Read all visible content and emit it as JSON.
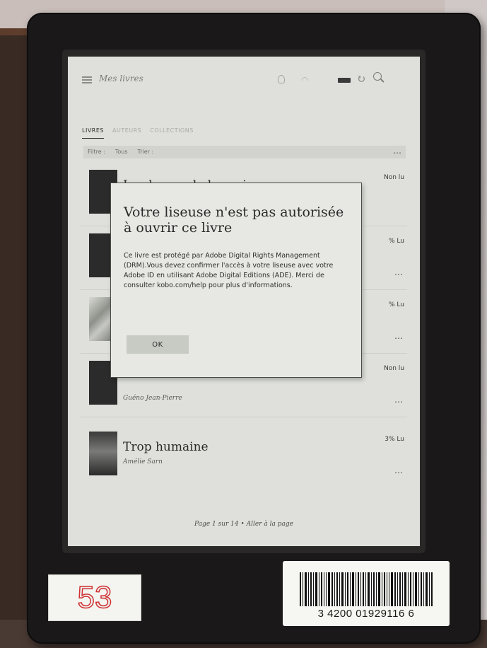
{
  "app_bar": {
    "title": "Mes livres"
  },
  "tabs": [
    {
      "label": "LIVRES"
    },
    {
      "label": "AUTEURS"
    },
    {
      "label": "COLLECTIONS"
    }
  ],
  "filter": {
    "label": "Filtre :",
    "value": "Tous",
    "sort": "Trier :",
    "more": "…"
  },
  "books": [
    {
      "title": "La chance de leur vie",
      "author": "",
      "status": "Non lu",
      "sub": ""
    },
    {
      "title": "",
      "author": "",
      "status": "% Lu",
      "sub": ""
    },
    {
      "title": "",
      "author": "",
      "status": "% Lu",
      "sub": ""
    },
    {
      "title": "",
      "author": "Guéno Jean-Pierre",
      "status": "Non lu",
      "sub": ""
    },
    {
      "title": "Trop humaine",
      "author": "Amélie Sarn",
      "status": "3% Lu",
      "sub": ""
    }
  ],
  "dialog": {
    "title": "Votre liseuse n'est pas autorisée à ouvrir ce livre",
    "body": "Ce livre est protégé par Adobe Digital Rights Management (DRM).Vous devez confirmer l'accès à votre liseuse avec votre Adobe ID en utilisant Adobe Digital Editions (ADE). Merci de consulter kobo.com/help pour plus d'informations.",
    "ok_label": "OK"
  },
  "pagination": {
    "text": "Page 1 sur 14 • Aller à la page"
  },
  "stickers": {
    "inventory_number": "53",
    "barcode_number": "3 4200 01929116 6"
  },
  "more_glyph": "…"
}
